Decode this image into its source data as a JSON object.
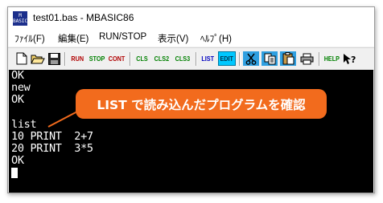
{
  "window": {
    "title": "test01.bas - MBASIC86",
    "app_icon_text": "M BASIC"
  },
  "menu": {
    "items": [
      {
        "label": "ﾌｧｲﾙ(F)"
      },
      {
        "label": "編集(E)"
      },
      {
        "label": "RUN/STOP"
      },
      {
        "label": "表示(V)"
      },
      {
        "label": "ﾍﾙﾌﾟ(H)"
      }
    ]
  },
  "toolbar": {
    "run": "RUN",
    "stop": "STOP",
    "cont": "CONT",
    "cls": "CLS",
    "cls2": "CLS2",
    "cls3": "CLS3",
    "list": "LIST",
    "edit": "EDIT",
    "help": "HELP",
    "colors": {
      "run": "#b00000",
      "stop": "#008000",
      "cls": "#008000",
      "list": "#0000c0",
      "edit_bg": "#00c8ff"
    }
  },
  "terminal": {
    "lines": [
      "OK",
      "new",
      "OK",
      "",
      "list",
      "10 PRINT  2+7",
      "20 PRINT  3*5",
      "OK"
    ]
  },
  "callout": {
    "text": "LIST で読み込んだプログラムを確認",
    "color": "#f26b1d"
  }
}
